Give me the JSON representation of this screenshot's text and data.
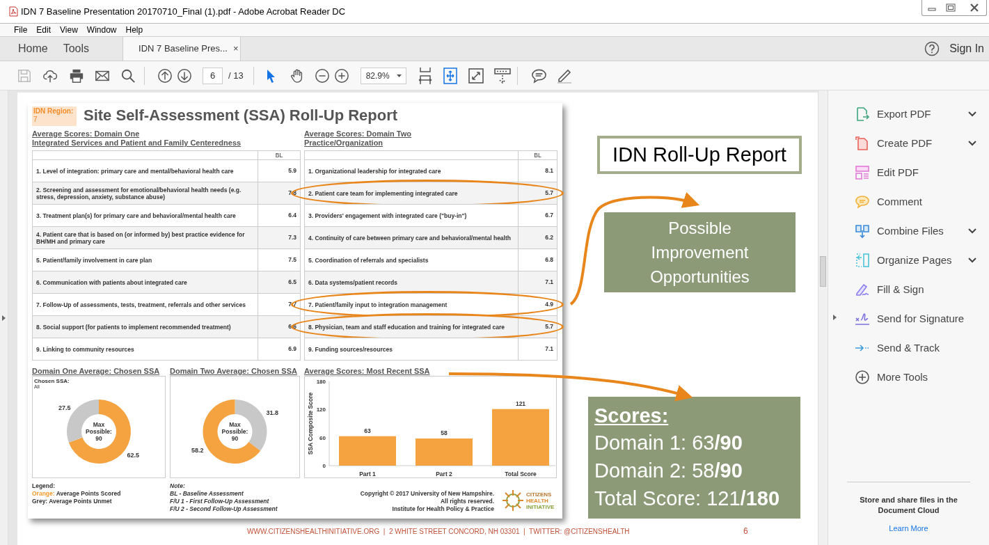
{
  "window": {
    "title": "IDN 7 Baseline Presentation 20170710_Final (1).pdf - Adobe Acrobat Reader DC"
  },
  "menu": [
    "File",
    "Edit",
    "View",
    "Window",
    "Help"
  ],
  "tabs": [
    {
      "kind": "nav",
      "label": "Home",
      "selected": false
    },
    {
      "kind": "nav",
      "label": "Tools",
      "selected": false
    },
    {
      "kind": "document",
      "label": "IDN 7 Baseline Pres...",
      "close": "×",
      "selected": true
    }
  ],
  "sign_in": "Sign In",
  "toolbar": {
    "page_number": "6",
    "page_total": "/ 13",
    "zoom": "82.9%"
  },
  "report": {
    "region_label": "IDN Region:",
    "region_value": "7",
    "title": "Site Self-Assessment (SSA) Roll-Up Report",
    "domains": [
      {
        "title": "Average Scores: Domain One",
        "subtitle": "Integrated Services and Patient and Family Centeredness",
        "column": "BL",
        "rows": [
          {
            "label": "1. Level of integration: primary care and mental/behavioral health care",
            "score": "5.9",
            "circled": false
          },
          {
            "label": "2. Screening and assessment for emotional/behavioral health needs (e.g. stress, depression, anxiety, substance abuse)",
            "score": "7.8",
            "circled": false
          },
          {
            "label": "3. Treatment plan(s) for primary care and behavioral/mental health care",
            "score": "6.4",
            "circled": false
          },
          {
            "label": "4. Patient care that is based on (or informed by) best practice evidence for BH/MH and primary care",
            "score": "7.3",
            "circled": false
          },
          {
            "label": "5. Patient/family involvement in care plan",
            "score": "7.5",
            "circled": false
          },
          {
            "label": "6. Communication with patients about integrated care",
            "score": "6.5",
            "circled": false
          },
          {
            "label": "7. Follow-Up of assessments, tests, treatment, referrals and other services",
            "score": "7.7",
            "circled": false
          },
          {
            "label": "8. Social support (for patients to implement recommended treatment)",
            "score": "6.6",
            "circled": false
          },
          {
            "label": "9. Linking to community resources",
            "score": "6.9",
            "circled": false
          }
        ]
      },
      {
        "title": "Average Scores: Domain Two",
        "subtitle": "Practice/Organization",
        "column": "BL",
        "rows": [
          {
            "label": "1. Organizational leadership for integrated care",
            "score": "8.1",
            "circled": false
          },
          {
            "label": "2. Patient care team for implementing integrated care",
            "score": "5.7",
            "circled": true
          },
          {
            "label": "3. Providers' engagement with integrated care (\"buy-in\")",
            "score": "6.7",
            "circled": false
          },
          {
            "label": "4. Continuity of care between primary care and behavioral/mental health",
            "score": "6.2",
            "circled": false
          },
          {
            "label": "5. Coordination of referrals and specialists",
            "score": "6.8",
            "circled": false
          },
          {
            "label": "6. Data systems/patient records",
            "score": "7.1",
            "circled": false
          },
          {
            "label": "7. Patient/family input to integration management",
            "score": "4.9",
            "circled": true
          },
          {
            "label": "8. Physician, team and staff education and training for integrated care",
            "score": "5.7",
            "circled": true
          },
          {
            "label": "9. Funding sources/resources",
            "score": "7.1",
            "circled": false
          }
        ]
      }
    ],
    "donuts": [
      {
        "title": "Domain One Average: Chosen SSA",
        "filter_label": "Chosen SSA:",
        "filter_value": "All",
        "center": "Max Possible: 90",
        "chart_data": {
          "type": "donut",
          "values": [
            62.5,
            27.5
          ],
          "colors": [
            "#f4a340",
            "#c8c8c8"
          ],
          "data_labels": true
        }
      },
      {
        "title": "Domain Two Average: Chosen SSA",
        "center": "Max Possible: 90",
        "chart_data": {
          "type": "donut",
          "values": [
            31.8,
            58.2
          ],
          "colors": [
            "#c8c8c8",
            "#f4a340"
          ],
          "data_labels": true
        }
      }
    ],
    "bar_chart": {
      "chart_data": {
        "type": "bar",
        "title": "Average Scores: Most Recent SSA",
        "ylabel": "SSA Composite Score",
        "categories": [
          "Part 1",
          "Part 2",
          "Total Score"
        ],
        "values": [
          63,
          58,
          121
        ],
        "ylim": [
          0,
          180
        ],
        "yticks": [
          0,
          60,
          120,
          180
        ],
        "data_labels": true
      }
    },
    "legend": {
      "title": "Legend:",
      "items": [
        {
          "name": "Orange:",
          "text": "Average Points Scored",
          "color": "#f39a2e"
        },
        {
          "name": "Grey:",
          "text": "Average Points Unmet",
          "color": "#333333"
        }
      ]
    },
    "note": {
      "title": "Note:",
      "lines": [
        "BL - Baseline Assessment",
        "F/U 1 - First Follow-Up Assessment",
        "F/U 2 - Second Follow-Up Assessment"
      ]
    },
    "copyright": [
      "Copyright © 2017 University of New Hampshire.",
      "All rights reserved.",
      "Institute for Health Policy & Practice"
    ],
    "logo": [
      "CITIZENS",
      "HEALTH",
      "INITIATIVE"
    ]
  },
  "slide": {
    "title_box": "IDN Roll-Up Report",
    "callout": "Possible Improvement Opportunities",
    "scores": {
      "heading": "Scores:",
      "lines": [
        "Domain 1: 63**/90**",
        "Domain 2: 58**/90**",
        "Total Score: 121**/180**"
      ]
    },
    "footer": "WWW.CITIZENSHEALTHINITIATIVE.ORG  |  2 WHITE STREET CONCORD, NH 03301  |  TWITTER: @CITIZENSHEALTH",
    "page_number": "6"
  },
  "tools_panel": {
    "items": [
      {
        "label": "Export PDF",
        "has_menu": true
      },
      {
        "label": "Create PDF",
        "has_menu": true
      },
      {
        "label": "Edit PDF",
        "has_menu": false
      },
      {
        "label": "Comment",
        "has_menu": false
      },
      {
        "label": "Combine Files",
        "has_menu": true
      },
      {
        "label": "Organize Pages",
        "has_menu": true
      },
      {
        "label": "Fill & Sign",
        "has_menu": false
      },
      {
        "label": "Send for Signature",
        "has_menu": false
      },
      {
        "label": "Send & Track",
        "has_menu": false
      },
      {
        "label": "More Tools",
        "has_menu": false
      }
    ],
    "promo": "Store and share files in the Document Cloud",
    "link": "Learn More"
  }
}
